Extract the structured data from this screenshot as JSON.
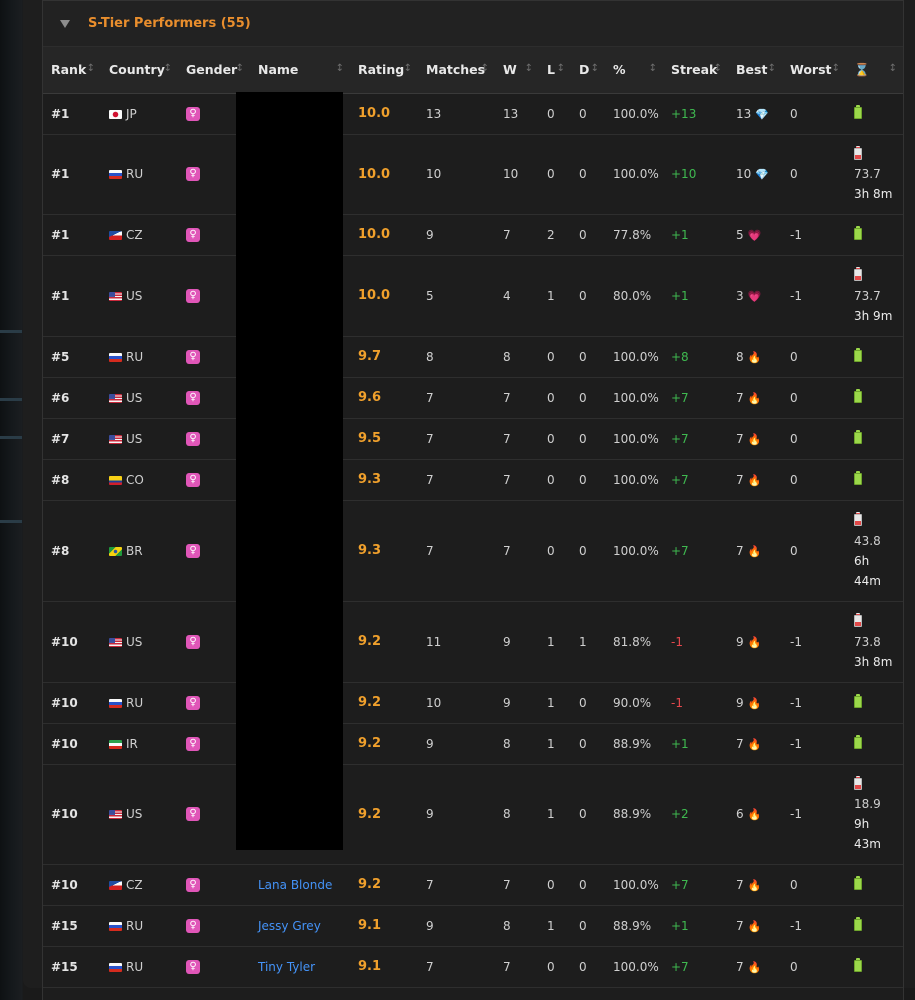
{
  "panel": {
    "title": "S-Tier Performers (55)"
  },
  "columns": [
    "Rank",
    "Country",
    "Gender",
    "Name",
    "Rating",
    "Matches",
    "W",
    "L",
    "D",
    "%",
    "Streak",
    "Best",
    "Worst",
    "⌛"
  ],
  "rows": [
    {
      "rank": "#1",
      "country": "JP",
      "flag": "jp",
      "gender": "♀",
      "name": "",
      "rating": "10.0",
      "matches": "13",
      "w": "13",
      "l": "0",
      "d": "0",
      "pct": "100.0%",
      "streak": "+13",
      "streak_dir": "pos",
      "best": "13",
      "best_icon": "diamond",
      "worst": "0",
      "status": "full",
      "timer": []
    },
    {
      "rank": "#1",
      "country": "RU",
      "flag": "ru",
      "gender": "♀",
      "name": "",
      "rating": "10.0",
      "matches": "10",
      "w": "10",
      "l": "0",
      "d": "0",
      "pct": "100.0%",
      "streak": "+10",
      "streak_dir": "pos",
      "best": "10",
      "best_icon": "diamond",
      "worst": "0",
      "status": "low",
      "timer": [
        "73.7",
        "3h 8m"
      ]
    },
    {
      "rank": "#1",
      "country": "CZ",
      "flag": "cz",
      "gender": "♀",
      "name": "",
      "rating": "10.0",
      "matches": "9",
      "w": "7",
      "l": "2",
      "d": "0",
      "pct": "77.8%",
      "streak": "+1",
      "streak_dir": "pos",
      "best": "5",
      "best_icon": "heart",
      "worst": "-1",
      "status": "full",
      "timer": []
    },
    {
      "rank": "#1",
      "country": "US",
      "flag": "us",
      "gender": "♀",
      "name": "",
      "rating": "10.0",
      "matches": "5",
      "w": "4",
      "l": "1",
      "d": "0",
      "pct": "80.0%",
      "streak": "+1",
      "streak_dir": "pos",
      "best": "3",
      "best_icon": "heart",
      "worst": "-1",
      "status": "low",
      "timer": [
        "73.7",
        "3h 9m"
      ]
    },
    {
      "rank": "#5",
      "country": "RU",
      "flag": "ru",
      "gender": "♀",
      "name": "",
      "rating": "9.7",
      "matches": "8",
      "w": "8",
      "l": "0",
      "d": "0",
      "pct": "100.0%",
      "streak": "+8",
      "streak_dir": "pos",
      "best": "8",
      "best_icon": "fire",
      "worst": "0",
      "status": "full",
      "timer": []
    },
    {
      "rank": "#6",
      "country": "US",
      "flag": "us",
      "gender": "♀",
      "name": "",
      "rating": "9.6",
      "matches": "7",
      "w": "7",
      "l": "0",
      "d": "0",
      "pct": "100.0%",
      "streak": "+7",
      "streak_dir": "pos",
      "best": "7",
      "best_icon": "fire",
      "worst": "0",
      "status": "full",
      "timer": []
    },
    {
      "rank": "#7",
      "country": "US",
      "flag": "us",
      "gender": "♀",
      "name": "",
      "rating": "9.5",
      "matches": "7",
      "w": "7",
      "l": "0",
      "d": "0",
      "pct": "100.0%",
      "streak": "+7",
      "streak_dir": "pos",
      "best": "7",
      "best_icon": "fire",
      "worst": "0",
      "status": "full",
      "timer": []
    },
    {
      "rank": "#8",
      "country": "CO",
      "flag": "co",
      "gender": "♀",
      "name": "",
      "rating": "9.3",
      "matches": "7",
      "w": "7",
      "l": "0",
      "d": "0",
      "pct": "100.0%",
      "streak": "+7",
      "streak_dir": "pos",
      "best": "7",
      "best_icon": "fire",
      "worst": "0",
      "status": "full",
      "timer": []
    },
    {
      "rank": "#8",
      "country": "BR",
      "flag": "br",
      "gender": "♀",
      "name": "",
      "rating": "9.3",
      "matches": "7",
      "w": "7",
      "l": "0",
      "d": "0",
      "pct": "100.0%",
      "streak": "+7",
      "streak_dir": "pos",
      "best": "7",
      "best_icon": "fire",
      "worst": "0",
      "status": "low",
      "timer": [
        "43.8",
        "6h",
        "44m"
      ]
    },
    {
      "rank": "#10",
      "country": "US",
      "flag": "us",
      "gender": "♀",
      "name": "",
      "rating": "9.2",
      "matches": "11",
      "w": "9",
      "l": "1",
      "d": "1",
      "pct": "81.8%",
      "streak": "-1",
      "streak_dir": "neg",
      "best": "9",
      "best_icon": "fire",
      "worst": "-1",
      "status": "low",
      "timer": [
        "73.8",
        "3h 8m"
      ]
    },
    {
      "rank": "#10",
      "country": "RU",
      "flag": "ru",
      "gender": "♀",
      "name": "",
      "rating": "9.2",
      "matches": "10",
      "w": "9",
      "l": "1",
      "d": "0",
      "pct": "90.0%",
      "streak": "-1",
      "streak_dir": "neg",
      "best": "9",
      "best_icon": "fire",
      "worst": "-1",
      "status": "full",
      "timer": []
    },
    {
      "rank": "#10",
      "country": "IR",
      "flag": "ir",
      "gender": "♀",
      "name": "",
      "rating": "9.2",
      "matches": "9",
      "w": "8",
      "l": "1",
      "d": "0",
      "pct": "88.9%",
      "streak": "+1",
      "streak_dir": "pos",
      "best": "7",
      "best_icon": "fire",
      "worst": "-1",
      "status": "full",
      "timer": []
    },
    {
      "rank": "#10",
      "country": "US",
      "flag": "us",
      "gender": "♀",
      "name": "",
      "rating": "9.2",
      "matches": "9",
      "w": "8",
      "l": "1",
      "d": "0",
      "pct": "88.9%",
      "streak": "+2",
      "streak_dir": "pos",
      "best": "6",
      "best_icon": "fire",
      "worst": "-1",
      "status": "low",
      "timer": [
        "18.9",
        "9h",
        "43m"
      ]
    },
    {
      "rank": "#10",
      "country": "CZ",
      "flag": "cz",
      "gender": "♀",
      "name": "Lana Blonde",
      "rating": "9.2",
      "matches": "7",
      "w": "7",
      "l": "0",
      "d": "0",
      "pct": "100.0%",
      "streak": "+7",
      "streak_dir": "pos",
      "best": "7",
      "best_icon": "fire",
      "worst": "0",
      "status": "full",
      "timer": []
    },
    {
      "rank": "#15",
      "country": "RU",
      "flag": "ru",
      "gender": "♀",
      "name": "Jessy Grey",
      "rating": "9.1",
      "matches": "9",
      "w": "8",
      "l": "1",
      "d": "0",
      "pct": "88.9%",
      "streak": "+1",
      "streak_dir": "pos",
      "best": "7",
      "best_icon": "fire",
      "worst": "-1",
      "status": "full",
      "timer": []
    },
    {
      "rank": "#15",
      "country": "RU",
      "flag": "ru",
      "gender": "♀",
      "name": "Tiny Tyler",
      "rating": "9.1",
      "matches": "7",
      "w": "7",
      "l": "0",
      "d": "0",
      "pct": "100.0%",
      "streak": "+7",
      "streak_dir": "pos",
      "best": "7",
      "best_icon": "fire",
      "worst": "0",
      "status": "full",
      "timer": []
    }
  ],
  "icons": {
    "diamond": "💎",
    "heart": "💗",
    "fire": "🔥",
    "sort": "↕"
  }
}
